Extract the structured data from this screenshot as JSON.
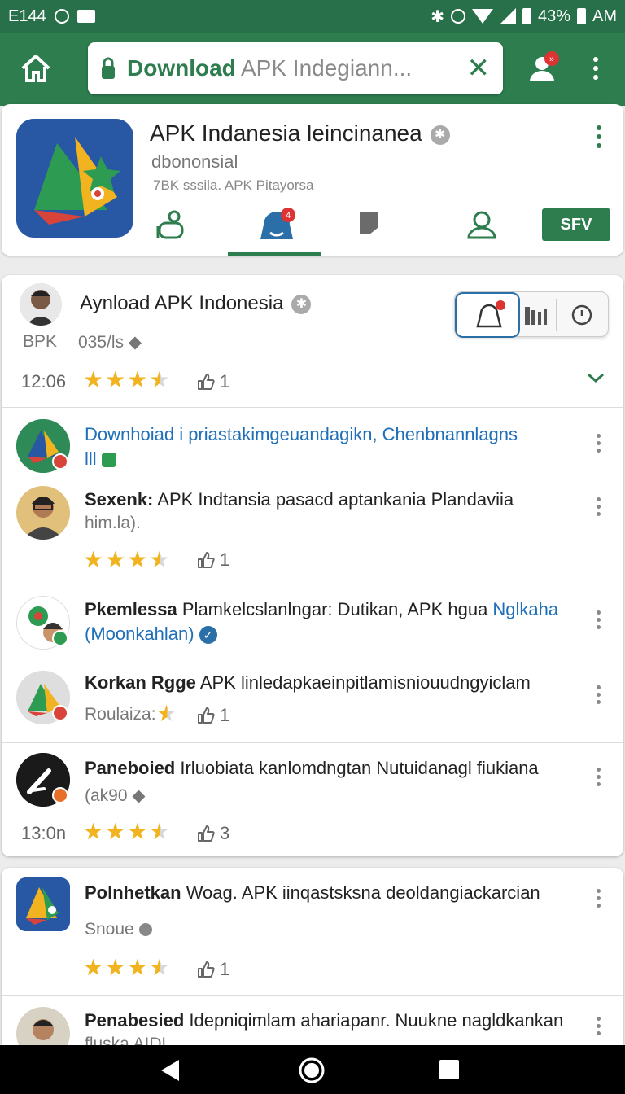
{
  "status_bar": {
    "left_text": "E144",
    "battery": "43%",
    "time_suffix": "AM"
  },
  "top_bar": {
    "url_bold": "Download",
    "url_rest": " APK Indegiann...",
    "close_glyph": "✕",
    "profile_badge": "»"
  },
  "app": {
    "title": "APK Indanesia leincinanea",
    "title_suffix_icon": "verified-gear-icon",
    "developer": "dbononsial",
    "meta": "7BK sssila. APK Pitayorsa",
    "save_label": "SFV",
    "tabs": [
      "share-icon",
      "notifications-icon",
      "bookmark-icon",
      "person-icon"
    ],
    "tab_badge": "4"
  },
  "feed": {
    "header": {
      "title": "Aynload APK Indonesia",
      "label": "BPK",
      "count": "035/ls",
      "time": "12:06",
      "rating": 3.5,
      "likes": "1"
    },
    "group1": {
      "link": "Downhoiad i priastakimgeuandagikn, Chenbnannlagns",
      "link_suffix": "lll",
      "post": {
        "author": "Sexenk:",
        "text": " APK Indtansia pasacd aptankania Plandaviia",
        "subtext": "him.la).",
        "rating": 3.5,
        "likes": "1"
      }
    },
    "group2": {
      "post1": {
        "author": "Pkemlessa",
        "text": " Plamkelcslanlngar: Dutikan, APK hgua ",
        "link": "Nglkaha (Moonkahlan)"
      },
      "post2": {
        "author": "Korkan Rgge",
        "text": " APK linledapkaeinpitlamisniouudngyiclam",
        "label": "Roulaiza:",
        "rating": 0.5,
        "likes": "1"
      }
    },
    "group3": {
      "author": "Paneboied",
      "text": " Irluobiata kanlomdngtan Nutuidanagl fiukiana",
      "subtext": "(ak90",
      "time": "13:0n",
      "rating": 3.5,
      "likes": "3"
    },
    "group4": {
      "post1": {
        "author": "Polnhetkan",
        "text": " Woag. APK iinqastsksna deoldangiackarcian",
        "subtext": "Snoue",
        "rating": 3.5,
        "likes": "1"
      },
      "post2": {
        "author": "Penabesied",
        "text": " Idepniqimlam ahariapanr. Nuukne nagldkankan",
        "subtext": "fluska AIDL"
      }
    }
  },
  "colors": {
    "brand_green": "#2e7d4f",
    "status_green": "#27704a",
    "link_blue": "#1f6fb8",
    "star": "#f2b320"
  }
}
